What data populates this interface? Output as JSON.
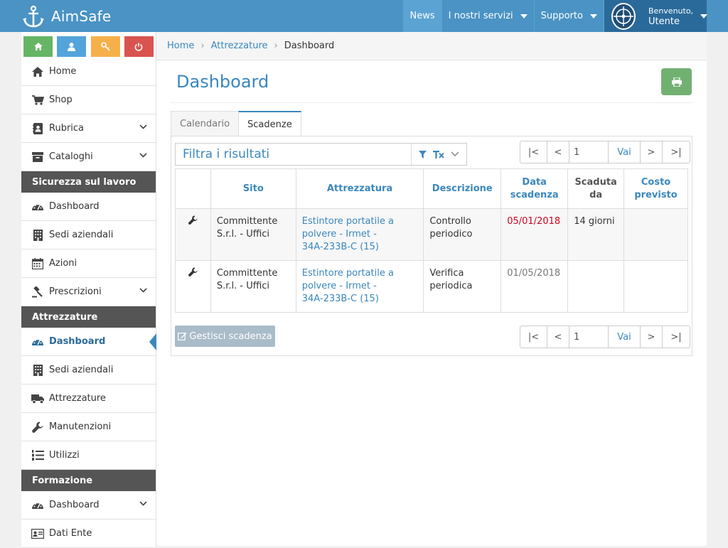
{
  "app": {
    "name": "AimSafe"
  },
  "topnav": {
    "items": [
      {
        "label": "News"
      },
      {
        "label": "I nostri servizi"
      },
      {
        "label": "Supporto"
      }
    ],
    "user": {
      "greeting": "Benvenuto,",
      "name": "Utente"
    }
  },
  "sidebar": {
    "quick_colors": [
      "#65b565",
      "#54a4dc",
      "#f6b04a",
      "#d9534f"
    ],
    "items_top": [
      {
        "label": "Home"
      },
      {
        "label": "Shop"
      },
      {
        "label": "Rubrica"
      },
      {
        "label": "Cataloghi"
      }
    ],
    "section1": {
      "title": "Sicurezza sul lavoro",
      "items": [
        {
          "label": "Dashboard"
        },
        {
          "label": "Sedi aziendali"
        },
        {
          "label": "Azioni"
        },
        {
          "label": "Prescrizioni"
        }
      ]
    },
    "section2": {
      "title": "Attrezzature",
      "items": [
        {
          "label": "Dashboard"
        },
        {
          "label": "Sedi aziendali"
        },
        {
          "label": "Attrezzature"
        },
        {
          "label": "Manutenzioni"
        },
        {
          "label": "Utilizzi"
        }
      ]
    },
    "section3": {
      "title": "Formazione",
      "items": [
        {
          "label": "Dashboard"
        },
        {
          "label": "Dati Ente"
        }
      ]
    }
  },
  "breadcrumb": {
    "home": "Home",
    "section": "Attrezzature",
    "current": "Dashboard"
  },
  "page": {
    "title": "Dashboard"
  },
  "tabs": [
    {
      "label": "Calendario"
    },
    {
      "label": "Scadenze"
    }
  ],
  "filter": {
    "placeholder": "Filtra i risultati"
  },
  "pager": {
    "first": "|<",
    "prev": "<",
    "page": "1",
    "go": "Vai",
    "next": ">",
    "last": ">|"
  },
  "table": {
    "headers": {
      "sito": "Sito",
      "attrezzatura": "Attrezzatura",
      "descrizione": "Descrizione",
      "data_l1": "Data",
      "data_l2": "scadenza",
      "scaduta_l1": "Scaduta",
      "scaduta_l2": "da",
      "costo_l1": "Costo",
      "costo_l2": "previsto"
    },
    "rows": [
      {
        "sito_l1": "Committente",
        "sito_l2": "S.r.l. - Uffici",
        "att_l1": "Estintore portatile a",
        "att_l2": "polvere - Irmet -",
        "att_l3": "34A-233B-C (15)",
        "desc_l1": "Controllo",
        "desc_l2": "periodico",
        "data": "05/01/2018",
        "scaduta": "14 giorni",
        "costo": ""
      },
      {
        "sito_l1": "Committente",
        "sito_l2": "S.r.l. - Uffici",
        "att_l1": "Estintore portatile a",
        "att_l2": "polvere - Irmet -",
        "att_l3": "34A-233B-C (15)",
        "desc_l1": "Verifica",
        "desc_l2": "periodica",
        "data": "01/05/2018",
        "scaduta": "",
        "costo": ""
      }
    ]
  },
  "actions": {
    "manage": "Gestisci scadenza"
  }
}
